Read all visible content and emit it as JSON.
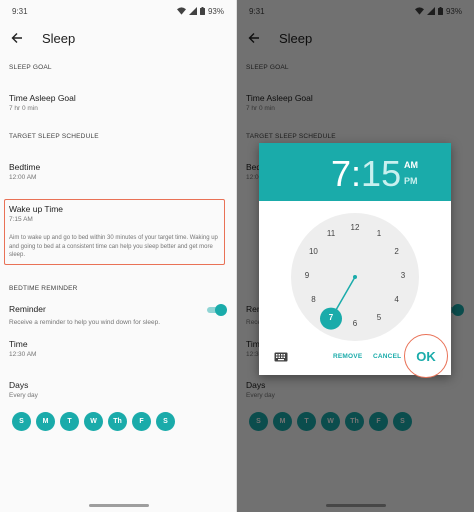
{
  "status": {
    "time": "9:31",
    "battery": "93%"
  },
  "appbar": {
    "title": "Sleep"
  },
  "sleep_goal": {
    "header": "SLEEP GOAL",
    "title": "Time Asleep Goal",
    "value": "7 hr 0 min"
  },
  "schedule": {
    "header": "TARGET SLEEP SCHEDULE",
    "bedtime_title": "Bedtime",
    "bedtime_value": "12:00 AM",
    "wake_title": "Wake up Time",
    "wake_value": "7:15 AM",
    "wake_desc": "Aim to wake up and go to bed within 30 minutes of your target time. Waking up and going to bed at a consistent time can help you sleep better and get more sleep."
  },
  "reminder": {
    "header": "BEDTIME REMINDER",
    "title": "Reminder",
    "desc": "Receive a reminder to help you wind down for sleep.",
    "enabled": true,
    "time_title": "Time",
    "time_value": "12:30 AM",
    "days_title": "Days",
    "days_value": "Every day",
    "days": [
      "S",
      "M",
      "T",
      "W",
      "Th",
      "F",
      "S"
    ]
  },
  "dialog": {
    "time_hour": "7",
    "time_colon": ":",
    "time_minute": "15",
    "am": "AM",
    "pm": "PM",
    "selected_period": "AM",
    "clock_numbers": [
      "12",
      "1",
      "2",
      "3",
      "4",
      "5",
      "6",
      "7",
      "8",
      "9",
      "10",
      "11"
    ],
    "selected_hour": 7,
    "remove_label": "REMOVE",
    "cancel_label": "CANCEL",
    "ok_label": "OK"
  },
  "colors": {
    "accent": "#1aabaa",
    "highlight": "#e97156"
  },
  "icons": [
    "wifi-icon",
    "signal-icon",
    "battery-icon",
    "back-arrow-icon",
    "keyboard-icon"
  ]
}
